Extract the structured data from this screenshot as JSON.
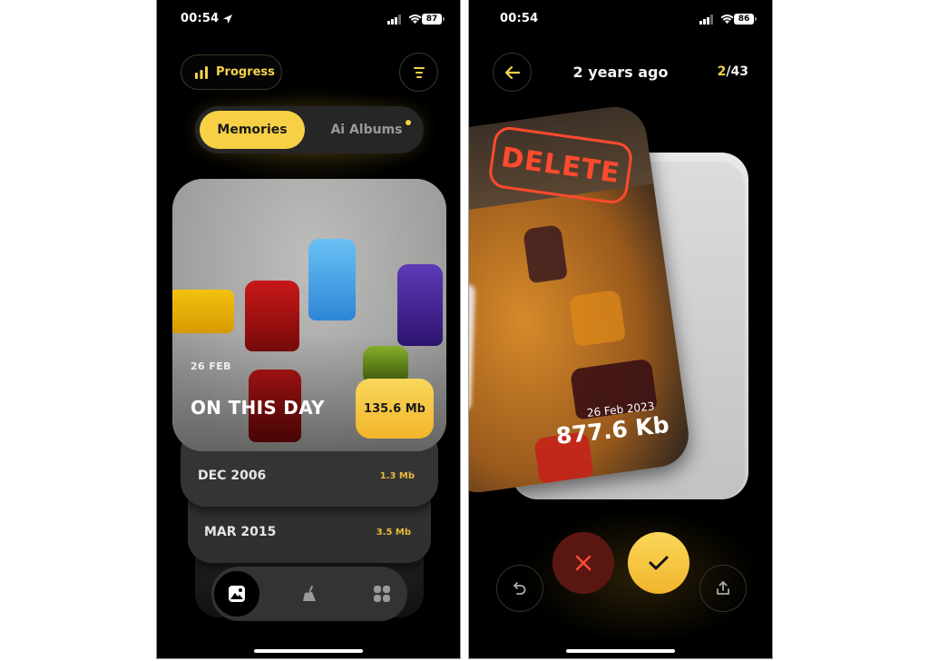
{
  "left_screen": {
    "status": {
      "time": "00:54",
      "battery": "87"
    },
    "header": {
      "progress_label": "Progress"
    },
    "segment": {
      "active": "Memories",
      "inactive": "Ai Albums"
    },
    "featured": {
      "date": "26 FEB",
      "title": "ON THIS DAY",
      "size": "135.6 Mb"
    },
    "memories": [
      {
        "label": "DEC 2006",
        "size": "1.3 Mb"
      },
      {
        "label": "MAR 2015",
        "size": "3.5 Mb"
      }
    ],
    "tabbar": {
      "items": [
        {
          "icon": "photo-icon",
          "active": true
        },
        {
          "icon": "broom-icon",
          "active": false
        },
        {
          "icon": "grid-icon",
          "active": false
        }
      ]
    }
  },
  "right_screen": {
    "status": {
      "time": "00:54",
      "battery": "86"
    },
    "header": {
      "title": "2 years ago",
      "counter_current": "2",
      "counter_total": "/43"
    },
    "card": {
      "stamp": "DELETE",
      "date": "26 Feb 2023",
      "size": "877.6 Kb"
    },
    "actions": [
      "undo-icon",
      "close-icon",
      "check-icon",
      "share-icon"
    ]
  },
  "colors": {
    "accent": "#f7d046",
    "delete": "#ff4a2e",
    "reject_bg": "#5a1712"
  }
}
